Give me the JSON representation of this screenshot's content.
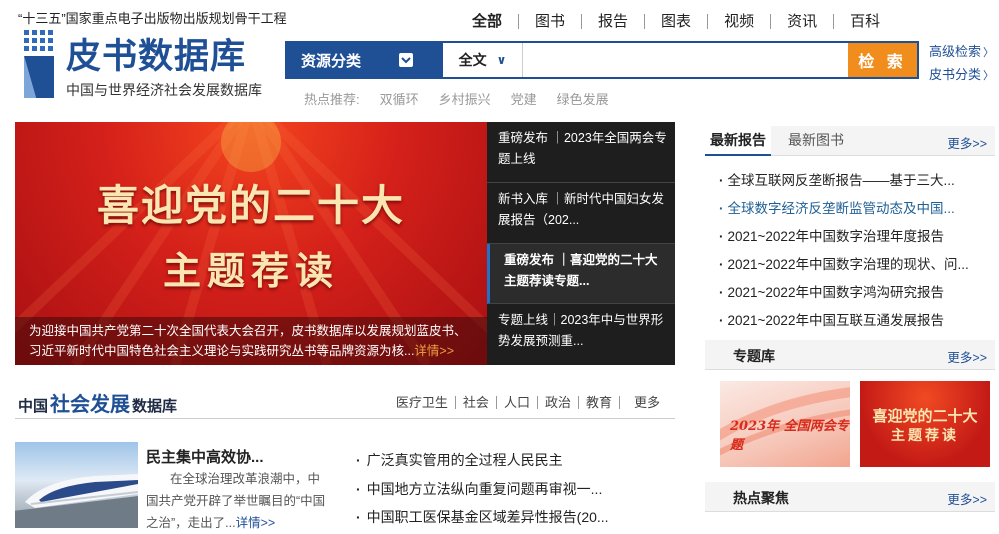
{
  "header": {
    "slogan": "“十三五”国家重点电子出版物出版规划骨干工程",
    "logo_title": "皮书数据库",
    "logo_subtitle": "中国与世界经济社会发展数据库",
    "nav": [
      "全部",
      "图书",
      "报告",
      "图表",
      "视频",
      "资讯",
      "百科"
    ],
    "nav_active": "全部"
  },
  "search": {
    "category_label": "资源分类",
    "scope": "全文",
    "scope_caret": "∨",
    "input_value": "",
    "button_label": "检 索",
    "advanced_link": "高级检索",
    "category_link": "皮书分类",
    "arrow": "〉",
    "hot_label": "热点推荐:",
    "hot_terms": [
      "双循环",
      "乡村振兴",
      "党建",
      "绿色发展"
    ]
  },
  "banner": {
    "line1": "喜迎党的二十大",
    "line2": "主题荐读",
    "caption": "为迎接中国共产党第二十次全国代表大会召开，皮书数据库以发展规划蓝皮书、习近平新时代中国特色社会主义理论与实践研究丛书等品牌资源为核...",
    "caption_more": "详情>>"
  },
  "news": [
    {
      "text": "重磅发布 ｜2023年全国两会专题上线"
    },
    {
      "text": "新书入库 ｜新时代中国妇女发展报告（202..."
    },
    {
      "text": "重磅发布 ｜喜迎党的二十大主题荐读专题..."
    },
    {
      "text": "专题上线｜2023年中与世界形势发展预测重..."
    }
  ],
  "social": {
    "title_prefix": "中国",
    "title_big": "社会发展",
    "title_suffix": "数据库",
    "tabs": [
      "医疗卫生",
      "社会",
      "人口",
      "政治",
      "教育",
      "更多"
    ],
    "feature_title": "民主集中高效协...",
    "feature_desc": "在全球治理改革浪潮中，中国共产党开辟了举世瞩目的“中国之治”，走出了...",
    "feature_more": "详情>>",
    "list": [
      "广泛真实管用的全过程人民民主",
      "中国地方立法纵向重复问题再审视一...",
      "中国职工医保基金区域差异性报告(20..."
    ]
  },
  "right": {
    "tab_active": "最新报告",
    "tab_other": "最新图书",
    "more": "更多>>",
    "reports": [
      "全球互联网反垄断报告——基于三大...",
      "全球数字经济反垄断监管动态及中国...",
      "2021~2022年中国数字治理年度报告",
      "2021~2022年中国数字治理的现状、问...",
      "2021~2022年中国数字鸿沟研究报告",
      "2021~2022年中国互联互通发展报告"
    ],
    "topic_title": "专题库",
    "topic_more": "更多>>",
    "thumb1_text": "2023年 全国两会专题",
    "thumb2_line1": "喜迎党的二十大",
    "thumb2_line2": "主题荐读",
    "hot_title": "热点聚焦",
    "hot_more": "更多>>"
  }
}
